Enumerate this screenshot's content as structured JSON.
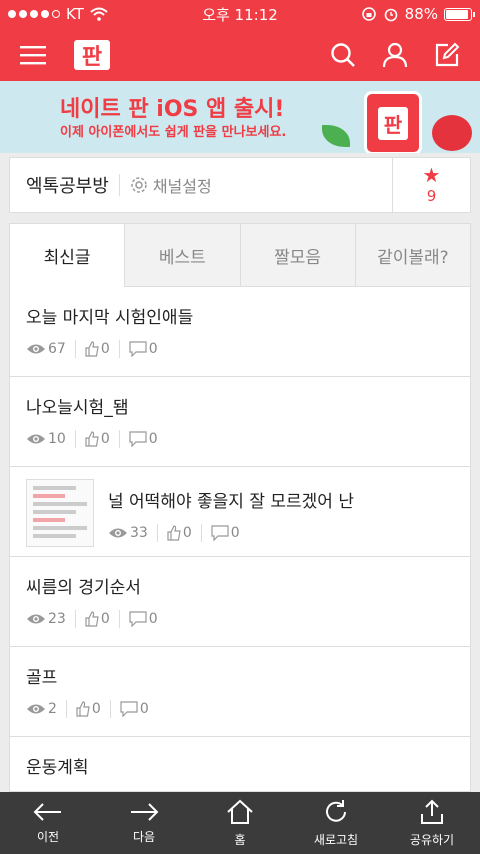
{
  "status_bar": {
    "carrier": "KT",
    "time": "오후 11:12",
    "battery": "88%",
    "battery_level": 0.88
  },
  "banner": {
    "title": "네이트 판 iOS 앱 출시!",
    "subtitle": "이제 아이폰에서도 쉽게 판을 만나보세요.",
    "logo_text": "판"
  },
  "header": {
    "logo": "판"
  },
  "channel": {
    "name": "엑톡공부방",
    "settings_label": "채널설정",
    "star_count": "9"
  },
  "tabs": [
    {
      "label": "최신글"
    },
    {
      "label": "베스트"
    },
    {
      "label": "짤모음"
    },
    {
      "label": "같이볼래?"
    }
  ],
  "posts": [
    {
      "title": "오늘 마지막 시험인애들",
      "views": "67",
      "likes": "0",
      "comments": "0"
    },
    {
      "title": "나오늘시험_됌",
      "views": "10",
      "likes": "0",
      "comments": "0"
    },
    {
      "title": "널 어떡해야 좋을지 잘 모르겠어 난",
      "views": "33",
      "likes": "0",
      "comments": "0"
    },
    {
      "title": "씨름의 경기순서",
      "views": "23",
      "likes": "0",
      "comments": "0"
    },
    {
      "title": "골프",
      "views": "2",
      "likes": "0",
      "comments": "0"
    },
    {
      "title": "운동계획",
      "views": "",
      "likes": "",
      "comments": ""
    }
  ],
  "toolbar": {
    "back": "이전",
    "forward": "다음",
    "home": "홈",
    "refresh": "새로고침",
    "share": "공유하기"
  },
  "colors": {
    "brand": "#ef3c45",
    "toolbar": "#3b3b3b",
    "banner_bg": "#cde8ef"
  }
}
